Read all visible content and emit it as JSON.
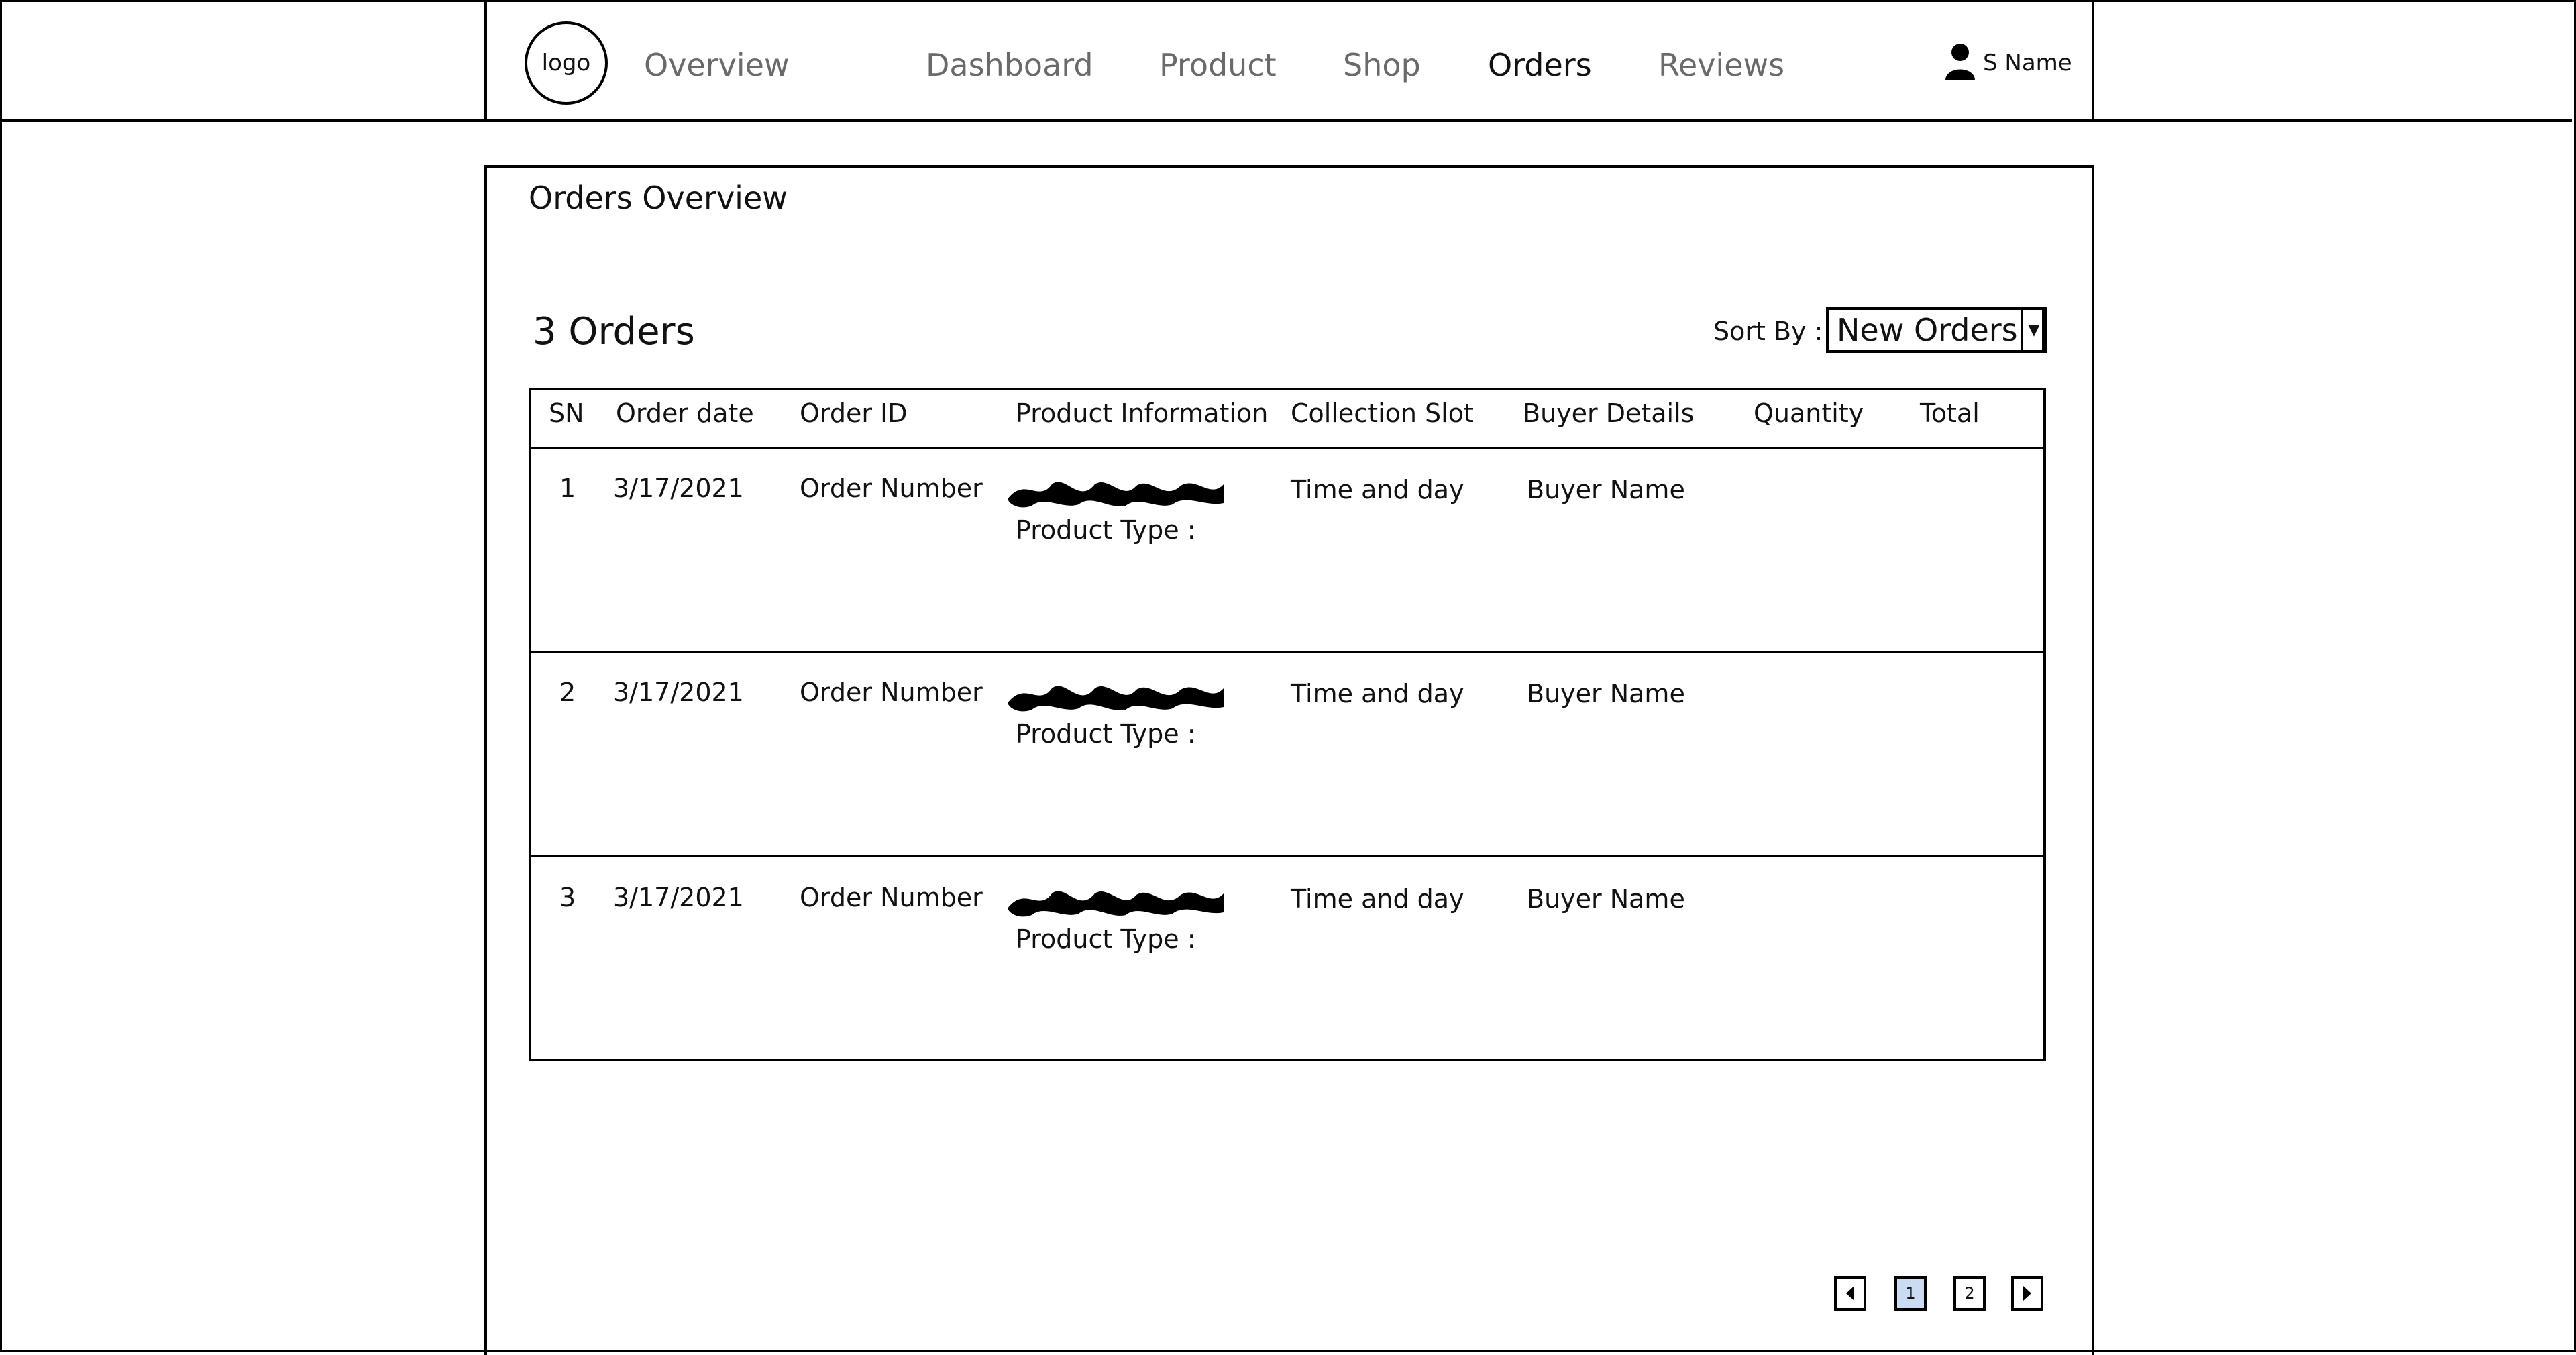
{
  "header": {
    "logo": "logo",
    "nav": [
      "Overview",
      "Dashboard",
      "Product",
      "Shop",
      "Orders",
      "Reviews"
    ],
    "active_nav": "Orders",
    "user_name": "S Name",
    "user_icon": "user-icon"
  },
  "panel": {
    "title": "Orders Overview",
    "count_label": "3 Orders",
    "sort_label": "Sort By :",
    "sort_value": "New Orders"
  },
  "table": {
    "columns": [
      "SN",
      "Order date",
      "Order ID",
      "Product Information",
      "Collection Slot",
      "Buyer Details",
      "Quantity",
      "Total"
    ],
    "rows": [
      {
        "sn": "1",
        "date": "3/17/2021",
        "order_id": "Order Number",
        "product_type": "Product Type :",
        "slot": "Time and day",
        "buyer": "Buyer Name"
      },
      {
        "sn": "2",
        "date": "3/17/2021",
        "order_id": "Order Number",
        "product_type": "Product Type :",
        "slot": "Time and day",
        "buyer": "Buyer Name"
      },
      {
        "sn": "3",
        "date": "3/17/2021",
        "order_id": "Order Number",
        "product_type": "Product Type :",
        "slot": "Time and day",
        "buyer": "Buyer Name"
      }
    ]
  },
  "pagination": {
    "pages": [
      "1",
      "2"
    ],
    "current": "1",
    "prev_icon": "caret-left-icon",
    "next_icon": "caret-right-icon"
  },
  "colors": {
    "active_page_fill": "#c9dcf2",
    "inactive_nav": "#6a6a6a"
  }
}
